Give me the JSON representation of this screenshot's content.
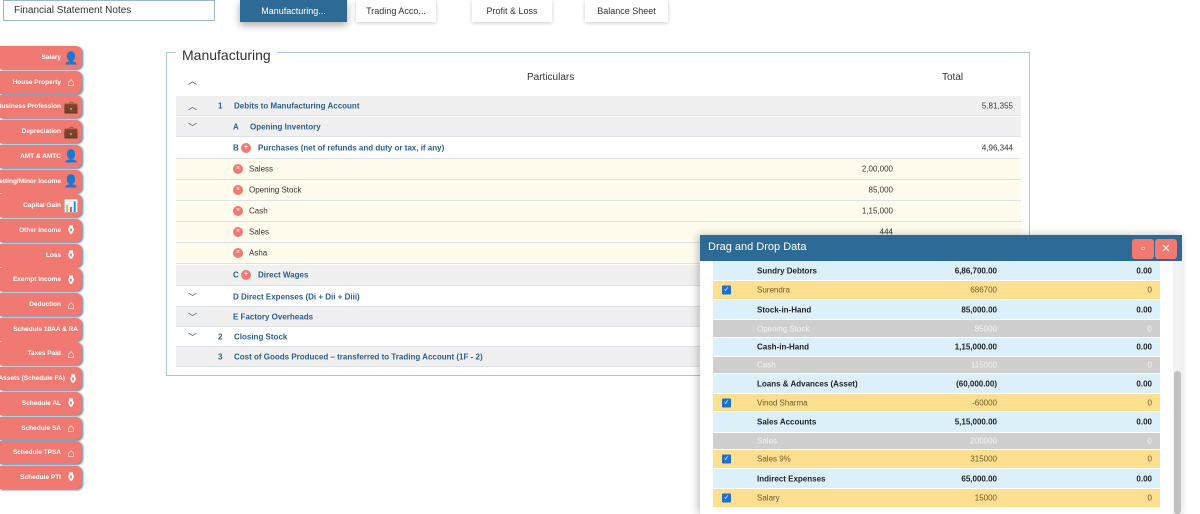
{
  "top_input": "Financial Statement Notes",
  "tabs": [
    "Manufacturing...",
    "Trading Acco...",
    "Profit & Loss",
    "Balance Sheet"
  ],
  "sidebar": [
    {
      "label": "Salary",
      "icon": "person-icon"
    },
    {
      "label": "House Property",
      "icon": "house-icon"
    },
    {
      "label": "Business Profession",
      "icon": "briefcase-icon"
    },
    {
      "label": "Depreciation",
      "icon": "briefcase-icon"
    },
    {
      "label": "AMT & AMTC",
      "icon": "person-icon"
    },
    {
      "label": "Betting/Minor Income",
      "icon": "person-icon"
    },
    {
      "label": "Capital Gain",
      "icon": "chart-icon"
    },
    {
      "label": "Other Income",
      "icon": "plant-icon"
    },
    {
      "label": "Loss",
      "icon": "plant-icon"
    },
    {
      "label": "Exempt Income",
      "icon": "plant-icon"
    },
    {
      "label": "Deduction",
      "icon": "house-icon"
    },
    {
      "label": "Schedule 10AA & RA",
      "icon": ""
    },
    {
      "label": "Taxes Paid",
      "icon": "house-icon"
    },
    {
      "label": "Assets (Schedule FA)",
      "icon": "plant-icon"
    },
    {
      "label": "Schedule AL",
      "icon": "plant-icon"
    },
    {
      "label": "Schedule SA",
      "icon": "house-icon"
    },
    {
      "label": "Schedule TPSA",
      "icon": "house-icon"
    },
    {
      "label": "Schedule PTI",
      "icon": "plant-icon"
    }
  ],
  "section": {
    "title": "Manufacturing",
    "col_particulars": "Particulars",
    "col_total": "Total",
    "rows": [
      {
        "num": "1",
        "label": "Debits to Manufacturing Account",
        "total": "5,81,355"
      },
      {
        "num": "A",
        "label": "Opening Inventory"
      },
      {
        "num": "B",
        "label": "Purchases (net of refunds and duty or tax, if any)",
        "total": "4,96,344"
      },
      {
        "label": "Saless",
        "amount": "2,00,000"
      },
      {
        "label": "Opening Stock",
        "amount": "85,000"
      },
      {
        "label": "Cash",
        "amount": "1,15,000"
      },
      {
        "label": "Sales",
        "amount": "444"
      },
      {
        "label": "Asha",
        "amount": ""
      },
      {
        "num": "C",
        "label": "Direct Wages"
      },
      {
        "label": "D Direct Expenses (Di + Dii + Diii)"
      },
      {
        "label": "E Factory Overheads"
      },
      {
        "num": "2",
        "label": "Closing Stock"
      },
      {
        "num": "3",
        "label": "Cost of Goods Produced – transferred to Trading Account (1F - 2)"
      }
    ]
  },
  "dialog": {
    "title": "Drag and Drop Data",
    "rows": [
      {
        "type": "group",
        "name": "Sundry Debtors",
        "amount": "6,86,700.00",
        "other": "0.00"
      },
      {
        "type": "checked",
        "name": "Surendra",
        "amount": "686700",
        "other": "0"
      },
      {
        "type": "group",
        "name": "Stock-in-Hand",
        "amount": "85,000.00",
        "other": "0.00"
      },
      {
        "type": "disabled",
        "name": "Opening Stock",
        "amount": "85000",
        "other": "0"
      },
      {
        "type": "group",
        "name": "Cash-in-Hand",
        "amount": "1,15,000.00",
        "other": "0.00"
      },
      {
        "type": "disabled",
        "name": "Cash",
        "amount": "115000",
        "other": "0"
      },
      {
        "type": "group",
        "name": "Loans & Advances (Asset)",
        "amount": "(60,000.00)",
        "other": "0.00"
      },
      {
        "type": "checked",
        "name": "Vinod Sharma",
        "amount": "-60000",
        "other": "0"
      },
      {
        "type": "group",
        "name": "Sales Accounts",
        "amount": "5,15,000.00",
        "other": "0.00"
      },
      {
        "type": "disabled",
        "name": "Sales",
        "amount": "200000",
        "other": "0"
      },
      {
        "type": "checked",
        "name": "Sales 9%",
        "amount": "315000",
        "other": "0"
      },
      {
        "type": "group",
        "name": "Indirect Expenses",
        "amount": "65,000.00",
        "other": "0.00"
      },
      {
        "type": "checked",
        "name": "Salary",
        "amount": "15000",
        "other": "0"
      }
    ]
  }
}
